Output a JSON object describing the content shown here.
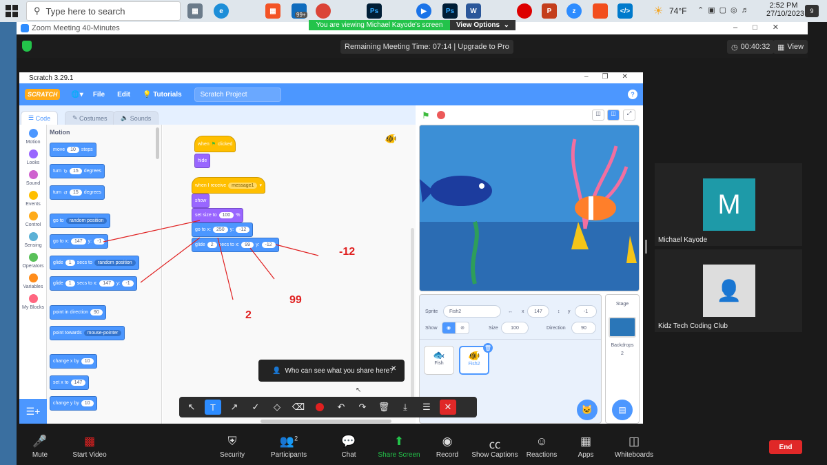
{
  "taskbar": {
    "search_placeholder": "Type here to search",
    "badge_count": "99+",
    "weather": "74°F",
    "time": "2:52 PM",
    "date": "27/10/2023",
    "notif_count": "9",
    "icons": [
      "windows-icon",
      "search-icon",
      "task-view-icon",
      "edge-icon",
      "store-icon",
      "mail-icon",
      "chrome-icon",
      "photoshop-icon",
      "teams-icon",
      "word-icon",
      "powerpoint-icon",
      "zoom-icon",
      "vscode-icon"
    ]
  },
  "zoom": {
    "window_title": "Zoom Meeting 40-Minutes",
    "viewing_banner": "You are viewing Michael Kayode's screen",
    "view_options": "View Options",
    "remaining": "Remaining Meeting Time: 07:14 | Upgrade to Pro",
    "timer": "00:40:32",
    "view_label": "View",
    "toast": "Who can see what you share here?",
    "participants_count": "2",
    "end_label": "End",
    "controls": [
      "Mute",
      "Start Video",
      "Security",
      "Participants",
      "Chat",
      "Share Screen",
      "Record",
      "Show Captions",
      "Reactions",
      "Apps",
      "Whiteboards"
    ],
    "tiles": [
      {
        "initial": "M",
        "name": "Michael Kayode"
      },
      {
        "name": "Kidz Tech Coding Club"
      }
    ]
  },
  "scratch": {
    "title": "Scratch 3.29.1",
    "logo": "SCRATCH",
    "menu": {
      "file": "File",
      "edit": "Edit",
      "tutorials": "Tutorials",
      "project": "Scratch Project"
    },
    "tabs": {
      "code": "Code",
      "costumes": "Costumes",
      "sounds": "Sounds"
    },
    "categories": [
      {
        "label": "Motion",
        "color": "#4c97ff"
      },
      {
        "label": "Looks",
        "color": "#9966ff"
      },
      {
        "label": "Sound",
        "color": "#cf63cf"
      },
      {
        "label": "Events",
        "color": "#ffbf00"
      },
      {
        "label": "Control",
        "color": "#ffab19"
      },
      {
        "label": "Sensing",
        "color": "#5cb1d6"
      },
      {
        "label": "Operators",
        "color": "#59c059"
      },
      {
        "label": "Variables",
        "color": "#ff8c1a"
      },
      {
        "label": "My Blocks",
        "color": "#ff6680"
      }
    ],
    "palette_heading": "Motion",
    "palette": {
      "move": {
        "a": "move",
        "v": "10",
        "b": "steps"
      },
      "turn_r": {
        "a": "turn",
        "v": "15",
        "b": "degrees"
      },
      "turn_l": {
        "a": "turn",
        "v": "15",
        "b": "degrees"
      },
      "goto": {
        "a": "go to",
        "d": "random position"
      },
      "gotoxy": {
        "a": "go to x:",
        "x": "147",
        "b": "y:",
        "y": "-1"
      },
      "glide_to": {
        "a": "glide",
        "v": "1",
        "b": "secs to",
        "d": "random position"
      },
      "glide_xy": {
        "a": "glide",
        "v": "1",
        "b": "secs to x:",
        "x": "147",
        "c": "y:",
        "y": "-1"
      },
      "point_dir": {
        "a": "point in direction",
        "v": "90"
      },
      "point_tow": {
        "a": "point towards",
        "d": "mouse-pointer"
      },
      "chg_x": {
        "a": "change x by",
        "v": "10"
      },
      "set_x": {
        "a": "set x to",
        "v": "147"
      },
      "chg_y": {
        "a": "change y by",
        "v": "10"
      }
    },
    "script": {
      "flag": {
        "a": "when",
        "b": "clicked"
      },
      "hide": "hide",
      "receive": {
        "a": "when I receive",
        "d": "message1"
      },
      "show": "show",
      "setsize": {
        "a": "set size to",
        "v": "100",
        "b": "%"
      },
      "goto": {
        "a": "go to x:",
        "x": "250",
        "b": "y:",
        "y": "-12"
      },
      "glide": {
        "a": "glide",
        "v": "2",
        "b": "secs to x:",
        "x": "99",
        "c": "y:",
        "y": "-12"
      }
    },
    "annotations": {
      "a1": "-12",
      "a2": "99",
      "a3": "2"
    },
    "sprite": {
      "sprite_label": "Sprite",
      "name": "Fish2",
      "x_label": "x",
      "x": "147",
      "y_label": "y",
      "y": "-1",
      "show_label": "Show",
      "size_label": "Size",
      "size": "100",
      "dir_label": "Direction",
      "direction": "90",
      "thumbs": [
        "Fish",
        "Fish2"
      ]
    },
    "stage_panel": {
      "title": "Stage",
      "backdrops_label": "Backdrops",
      "backdrops": "2"
    }
  }
}
